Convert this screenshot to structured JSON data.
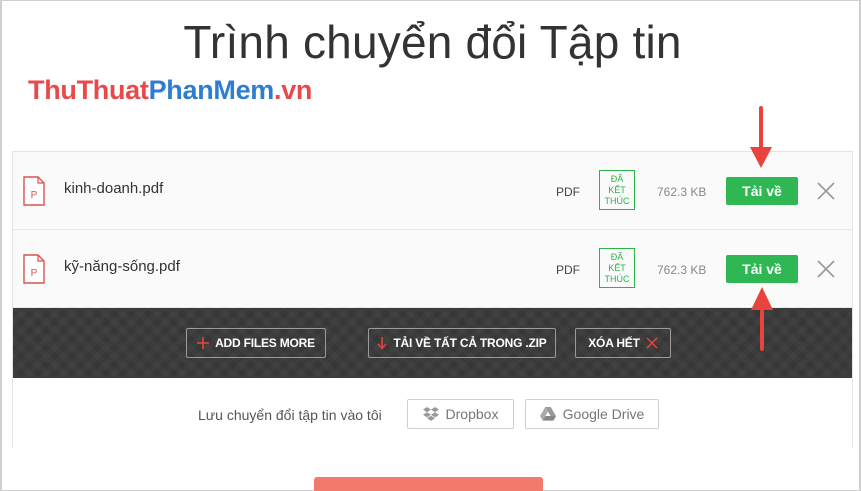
{
  "page": {
    "title": "Trình chuyển đổi Tập tin"
  },
  "watermark": {
    "part1": "ThuThuat",
    "part2": "PhanMem",
    "part3": ".vn"
  },
  "files": [
    {
      "name": "kinh-doanh.pdf",
      "type": "PDF",
      "status": "ĐÃ\nKẾT\nTHÚC",
      "size": "762.3 KB",
      "download_label": "Tải về"
    },
    {
      "name": "kỹ-năng-sống.pdf",
      "type": "PDF",
      "status": "ĐÃ\nKẾT\nTHÚC",
      "size": "762.3 KB",
      "download_label": "Tải về"
    }
  ],
  "action_bar": {
    "add_files_label": "ADD FILES MORE",
    "download_zip_label": "TẢI VỀ TẤT CẢ TRONG .ZIP",
    "clear_all_label": "XÓA HẾT"
  },
  "save_to": {
    "label": "Lưu chuyển đổi tập tin vào tôi",
    "dropbox_label": "Dropbox",
    "gdrive_label": "Google Drive"
  },
  "colors": {
    "accent_green": "#2eb753",
    "accent_red": "#e8494a",
    "annotation_red": "#e8433c"
  }
}
